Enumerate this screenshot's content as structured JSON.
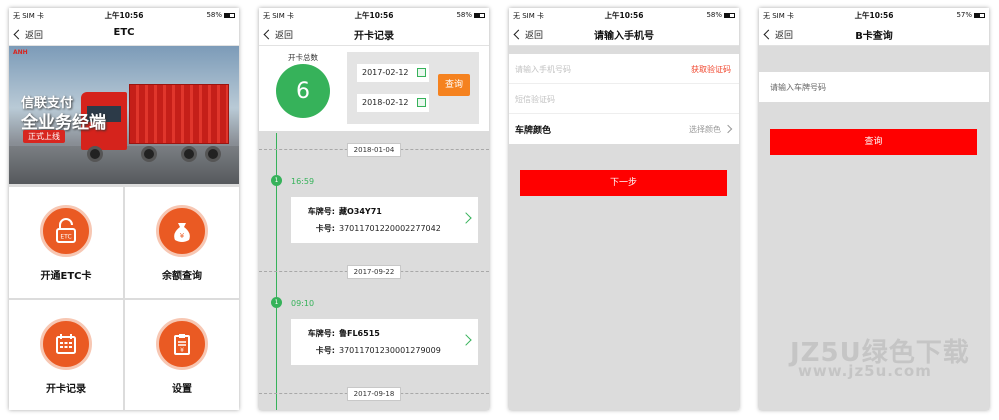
{
  "status": {
    "s1": {
      "carrier": "无 SIM 卡",
      "time": "上午10:56",
      "battery": "58%"
    },
    "s2": {
      "carrier": "无 SIM 卡",
      "time": "上午10:56",
      "battery": "58%"
    },
    "s3": {
      "carrier": "无 SIM 卡",
      "time": "上午10:56",
      "battery": "58%"
    },
    "s4": {
      "carrier": "无 SIM 卡",
      "time": "上午10:56",
      "battery": "57%"
    }
  },
  "back_label": "返回",
  "screen1": {
    "title": "ETC",
    "banner": {
      "logo": "ANH",
      "line1": "信联支付",
      "line2": "全业务经端",
      "badge": "正式上线"
    },
    "tiles": [
      {
        "label": "开通ETC卡",
        "icon": "lock-etc-icon"
      },
      {
        "label": "余额查询",
        "icon": "money-bag-icon"
      },
      {
        "label": "开卡记录",
        "icon": "calendar-icon"
      },
      {
        "label": "设置",
        "icon": "settings-doc-icon"
      }
    ]
  },
  "screen2": {
    "title": "开卡记录",
    "total_label": "开卡总数",
    "total": "6",
    "date_start": "2017-02-12",
    "date_end": "2018-02-12",
    "query_label": "查询",
    "groups": [
      {
        "date": "2018-01-04",
        "time": "16:59",
        "plate_key": "车牌号:",
        "plate": "藏O34Y71",
        "card_key": "卡号:",
        "card": "37011701220002277042"
      },
      {
        "date": "2017-09-22",
        "time": "09:10",
        "plate_key": "车牌号:",
        "plate": "鲁FL6515",
        "card_key": "卡号:",
        "card": "37011701230001279009"
      },
      {
        "date": "2017-09-18"
      }
    ],
    "dot_label": "1"
  },
  "screen3": {
    "title": "请输入手机号",
    "phone_placeholder": "请输入手机号码",
    "get_code": "获取验证码",
    "sms_placeholder": "短信验证码",
    "color_label": "车牌颜色",
    "color_select": "选择颜色",
    "next_button": "下一步"
  },
  "screen4": {
    "title": "B卡查询",
    "plate_placeholder": "请输入车牌号码",
    "query_button": "查询"
  },
  "watermark": {
    "line1": "JZ5U绿色下载",
    "line2": "www.jz5u.com"
  },
  "colors": {
    "accent_orange": "#ea5a23",
    "green": "#36b25a",
    "red_button": "#ff0000",
    "query_orange": "#f5821f"
  }
}
